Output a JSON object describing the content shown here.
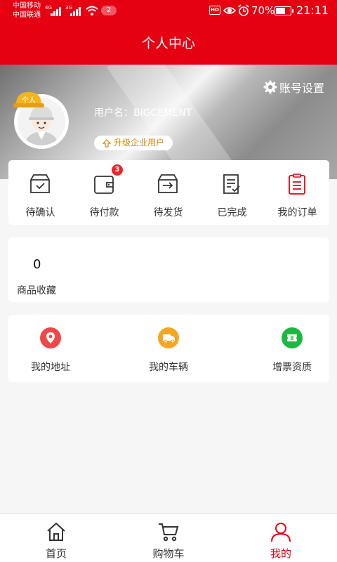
{
  "status_bar": {
    "carrier_1": "中国移动",
    "carrier_2": "中国联通",
    "network_1": "4G",
    "network_2": "3G",
    "notification_count": "2",
    "hd_label": "HD",
    "battery_percent": "70%",
    "battery_level": 0.7,
    "time": "21:11"
  },
  "header": {
    "title": "个人中心"
  },
  "profile": {
    "settings_label": "账号设置",
    "vip_badge": "个人",
    "username": "用户名：BIGCEMENT",
    "upgrade_label": "升级企业用户"
  },
  "orders": {
    "items": [
      {
        "label": "待确认",
        "icon": "box-check-icon"
      },
      {
        "label": "待付款",
        "icon": "wallet-icon",
        "badge": "3"
      },
      {
        "label": "待发货",
        "icon": "box-shipping-icon"
      },
      {
        "label": "已完成",
        "icon": "document-check-icon"
      },
      {
        "label": "我的订单",
        "icon": "order-list-icon"
      }
    ]
  },
  "favorites": {
    "count": "0",
    "label": "商品收藏"
  },
  "services": {
    "items": [
      {
        "label": "我的地址",
        "icon": "location-pin-icon",
        "color": "#f04848"
      },
      {
        "label": "我的车辆",
        "icon": "truck-icon",
        "color": "#f5a623"
      },
      {
        "label": "增票资质",
        "icon": "invoice-ticket-icon",
        "color": "#1db83f"
      }
    ]
  },
  "tabbar": {
    "items": [
      {
        "label": "首页",
        "icon": "home-icon"
      },
      {
        "label": "购物车",
        "icon": "cart-icon"
      },
      {
        "label": "我的",
        "icon": "user-icon",
        "active": true
      }
    ]
  },
  "colors": {
    "brand": "#e50012",
    "accent_gold": "#d48a0c",
    "badge": "#e8262e"
  }
}
